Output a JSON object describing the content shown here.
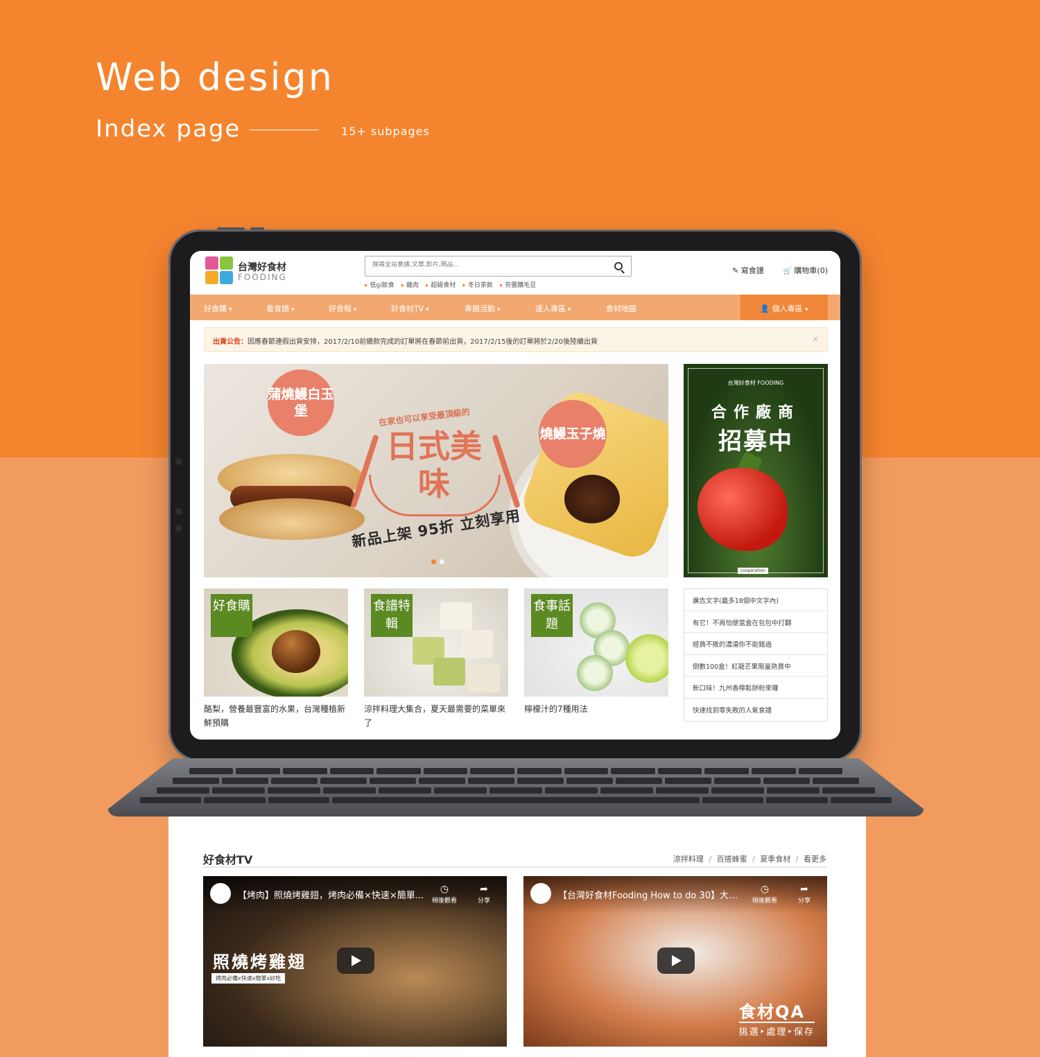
{
  "hero": {
    "title": "Web design",
    "subtitle": "Index page",
    "subpages": "15+ subpages"
  },
  "site": {
    "logo_zh": "台灣好食材",
    "logo_en": "FOODING",
    "search_placeholder": "搜尋全站食譜,文章,影片,商品...",
    "hot_tags": [
      "低gi飲食",
      "雞肉",
      "超級食材",
      "冬日茶飲",
      "夯團購毛豆"
    ],
    "header_links": {
      "write_recipe": "寫食譜",
      "cart": "購物車(0)"
    },
    "nav": [
      "好食購",
      "看食譜",
      "好食報",
      "好食材TV",
      "專題活動",
      "達人專區",
      "食材地圖"
    ],
    "nav_personal": "個人專區",
    "notice_label": "出貨公告：",
    "notice_text": "因應春節連假出貨安排，2017/2/10前繳款完成的訂單將在春節前出貨，2017/2/15後的訂單將於2/20後陸續出貨",
    "notice_close": "×"
  },
  "banner": {
    "bubble1": "蒲燒鰻白玉堡",
    "bubble2": "燒鰻玉子燒",
    "eyebrow": "在家也可以享受最頂級的",
    "main": "日式美味",
    "promo": "新品上架 95折 立刻享用"
  },
  "side_ad": {
    "brand": "台灣好食材 FOODING",
    "line1": "合作廠商",
    "line2": "招募中",
    "tag": "cooperation"
  },
  "tiles": [
    {
      "label": "好食購",
      "caption": "酪梨，營養最豐富的水果，台灣種植新鮮預購"
    },
    {
      "label": "食譜特輯",
      "caption": "涼拌料理大集合，夏天最需要的菜單來了"
    },
    {
      "label": "食事話題",
      "caption": "檸檬汁的7種用法"
    }
  ],
  "side_list": [
    "廣告文字(最多18個中文字內)",
    "有它！不再怕便當盒在包包中打翻",
    "經典不敗的濃湯你不能錯過",
    "倒數100盒！紅龍芒果限量熱賣中",
    "新口味！九州香檸鬆餅粉來囉",
    "快速找到零失敗的人氣食譜"
  ],
  "tv": {
    "title": "好食材TV",
    "tags": [
      "涼拌料理",
      "百搭蜂蜜",
      "夏季食材",
      "看更多"
    ],
    "videos": [
      {
        "title": "【烤肉】照燒烤雞翅，烤肉必備×快速×簡單...",
        "watch_later": "稍後觀看",
        "share": "分享",
        "overlay": "照燒烤雞翅",
        "overlay_sub": "烤肉必備x快速x簡單x好吃"
      },
      {
        "title": "【台灣好食材Fooding How to do 30】大蒜...",
        "watch_later": "稍後觀看",
        "share": "分享",
        "overlay": "食材QA",
        "overlay_sub": "挑選‣處理‣保存"
      }
    ]
  },
  "colors": {
    "orange_top": "#f5842f",
    "orange_bottom": "#f29b5e",
    "nav": "#f3a86f",
    "accent_green": "#5b8a22",
    "salmon": "#e07457"
  }
}
